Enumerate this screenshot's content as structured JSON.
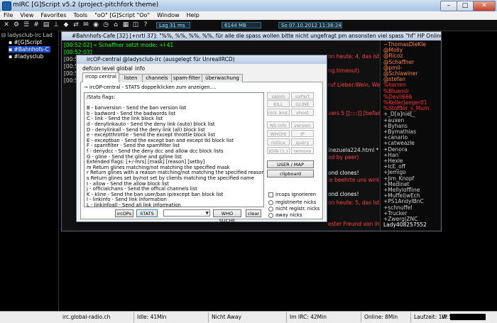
{
  "window": {
    "title": "mIRC [G]Script v5.2 (project-pitchfork theme)",
    "controls": {
      "minimize": "–",
      "maximize": "□",
      "close": "✕"
    }
  },
  "menu": [
    "File",
    "View",
    "Favorites",
    "Tools",
    "\"oO\" [G]Script \"Oo\"",
    "Window",
    "Help"
  ],
  "toolbar": {
    "lag_label": "Lag",
    "lag_value": "31 ms",
    "meter_value": "6144 MB",
    "date": "So",
    "date_full": "07.10.2012",
    "time": "11:38:24"
  },
  "tree": {
    "server": "ladysclub-irc Lad",
    "items": [
      "#[G]Script",
      "#Bahnhofs-C",
      "#ladysclub"
    ]
  },
  "channel": {
    "title": "#Bahnhofs-Cafe [32] [+nrtl 37]: \"%%, %%, %%, %%, für alle die spass wollen bitte nicht ungefragt pm ansonsten viel spass \"hf\" HP Online  www.tommys-...",
    "lines": [
      {
        "text": "[00:52:02] » Schaffner setzt mode: +l 41",
        "color": "#00ff00"
      },
      {
        "text": "[00:52:03] ",
        "color": "#00ff00"
      },
      {
        "text": "[00:5",
        "color": "#cccccc"
      },
      {
        "text": "[00:5",
        "color": "#cccccc"
      },
      {
        "text": "[00:5",
        "color": "#cccccc"
      },
      {
        "text": "[00:5",
        "color": "#cccccc"
      }
    ],
    "right_fragments": [
      {
        "text": "on heute: 4, das ist der",
        "color": "#ff4040"
      },
      {
        "text": "ng.timeout)",
        "color": "#ff4040"
      },
      {
        "text": "ruf Lieber:Wein, Weib und",
        "color": "#ff4040"
      },
      {
        "text": "vers 5 [[::::]] [befaded by",
        "color": "#ff4040"
      },
      {
        "text": "inezuela224.html *",
        "color": "#dddddd"
      },
      {
        "text": "ed by peer)",
        "color": "#ff4040"
      },
      {
        "text": "ond clones!",
        "color": "#ffffff"
      },
      {
        "text": "ie beehrte uns wirklich mal",
        "color": "#ff4040"
      },
      {
        "text": "ond clones!",
        "color": "#ffffff"
      },
      {
        "text": "on heute: 5, das ist der",
        "color": "#ff4040"
      },
      {
        "text": "ester Freund von ihm halt...",
        "color": "#ff4040"
      }
    ],
    "nicks": [
      {
        "n": "~ThomasDieKle",
        "c": "#ff8040"
      },
      {
        "n": "@Molly",
        "c": "#ff8040"
      },
      {
        "n": "@Ricoz",
        "c": "#ff8040"
      },
      {
        "n": "@Schaffner",
        "c": "#ff8040"
      },
      {
        "n": "@pmil-",
        "c": "#ff8040"
      },
      {
        "n": "@Schlawiner",
        "c": "#ff8040"
      },
      {
        "n": "@stefan",
        "c": "#ff8040"
      },
      {
        "n": "%herren",
        "c": "#ff3030"
      },
      {
        "n": "%BluemIi",
        "c": "#ff3030"
      },
      {
        "n": "%Devil666",
        "c": "#ff3030"
      },
      {
        "n": "%KellerJaeger01",
        "c": "#ff3030"
      },
      {
        "n": "%Stoffler_s_Mum",
        "c": "#ff3030"
      },
      {
        "n": "+_D[a]nie[_",
        "c": "#cfcfcf"
      },
      {
        "n": "+auxen",
        "c": "#cfcfcf"
      },
      {
        "n": "+Byhans",
        "c": "#cfcfcf"
      },
      {
        "n": "+Bymathias",
        "c": "#cfcfcf"
      },
      {
        "n": "+canario",
        "c": "#cfcfcf"
      },
      {
        "n": "+catweazle",
        "c": "#cfcfcf"
      },
      {
        "n": "+Denora",
        "c": "#cfcfcf"
      },
      {
        "n": "+Han`",
        "c": "#cfcfcf"
      },
      {
        "n": "+Hexle",
        "c": "#cfcfcf"
      },
      {
        "n": "+IcE_off",
        "c": "#cfcfcf"
      },
      {
        "n": "+Jemigo",
        "c": "#cfcfcf"
      },
      {
        "n": "+Jim_Knopf",
        "c": "#cfcfcf"
      },
      {
        "n": "+Medinet",
        "c": "#cfcfcf"
      },
      {
        "n": "+Mellyloffline",
        "c": "#cfcfcf"
      },
      {
        "n": "+Muffel|wEch",
        "c": "#cfcfcf"
      },
      {
        "n": "+PS1AndyIBnC",
        "c": "#cfcfcf"
      },
      {
        "n": "+schnuffel",
        "c": "#cfcfcf"
      },
      {
        "n": "+Trucker",
        "c": "#cfcfcf"
      },
      {
        "n": "+Zwerg|ZNC",
        "c": "#cfcfcf"
      },
      {
        "n": "Lady408257552",
        "c": "#ffffff"
      }
    ]
  },
  "dialog": {
    "title": "ircOP-central @ladysclub-irc (ausgelegt für UnrealIRCD)",
    "menu": [
      "defcon level",
      "global",
      "info"
    ],
    "tabs": [
      "ircop central",
      "listen",
      "channels",
      "spam-filter",
      "überwachung"
    ],
    "section_label": "ircOP-central - STATS doppelklicken zum anzeigen....",
    "flags": [
      "/Stats flags:",
      "",
      "B - banversion - Send the ban version list",
      "b - badword - Send the badwords list",
      "C - link - Send the link block list",
      "d - denylinkauto - Send the deny link (auto) block list",
      "D - denylinkall - Send the deny link (all) block list",
      "e - exceptthrottle - Send the except throttle block list",
      "E - exceptban - Send the except ban and except tkl block list",
      "F - spamfilter - Send the spamfilter list",
      "f - denydcc - Send the deny dcc and allow dcc block lists",
      "G - gline - Send the gline and gzline list",
      "Extended flags: [+/-mrs] [mask] [reason] [setby]",
      "m Return glines matching/not matching the specified mask",
      "r Return glines with a reason matching/not matching the specified reason",
      "s Return glines set by/not set by clients matching the specified name",
      "I - allow - Send the allow block list",
      "j - officialchans - Send the offical channels list",
      "K - kline - Send the ban user/ban ip/except ban block list",
      "l - linkinfo - Send link information",
      "L - linkinfoall - Send all link information"
    ],
    "side_buttons": [
      [
        "saJoin",
        "saPart"
      ],
      [
        "KILL",
        "GLINE"
      ],
      [
        "nick änd.",
        "vhost"
      ],
      [
        "NS-info",
        "version"
      ],
      [
        "WHOIS",
        "IP"
      ],
      [
        "notice",
        "query"
      ],
      [
        "JOIN (1.)",
        "remove"
      ]
    ],
    "user_map": "USER / MAP",
    "clipboard": "clipboard",
    "ignore_label": "ircops ignorieren",
    "radios": [
      "registrierte nicks",
      "nicht registr. nicks",
      "away nicks"
    ],
    "bottom": {
      "ircops": "ircOPs",
      "stats": "STATS",
      "who": "WHO SUCHE",
      "clear": "clear",
      "combo_arrow": "▼"
    }
  },
  "status": {
    "server": "irc.global-radio.ch",
    "idle": "Idle: 41Min",
    "away": "Nicht Away",
    "im_irc": "Im IRC: 42Min",
    "online": "Online: 8Min",
    "uptime": "Laufzeit: 1W 5Std 8Min",
    "ip_label": "IP:"
  }
}
